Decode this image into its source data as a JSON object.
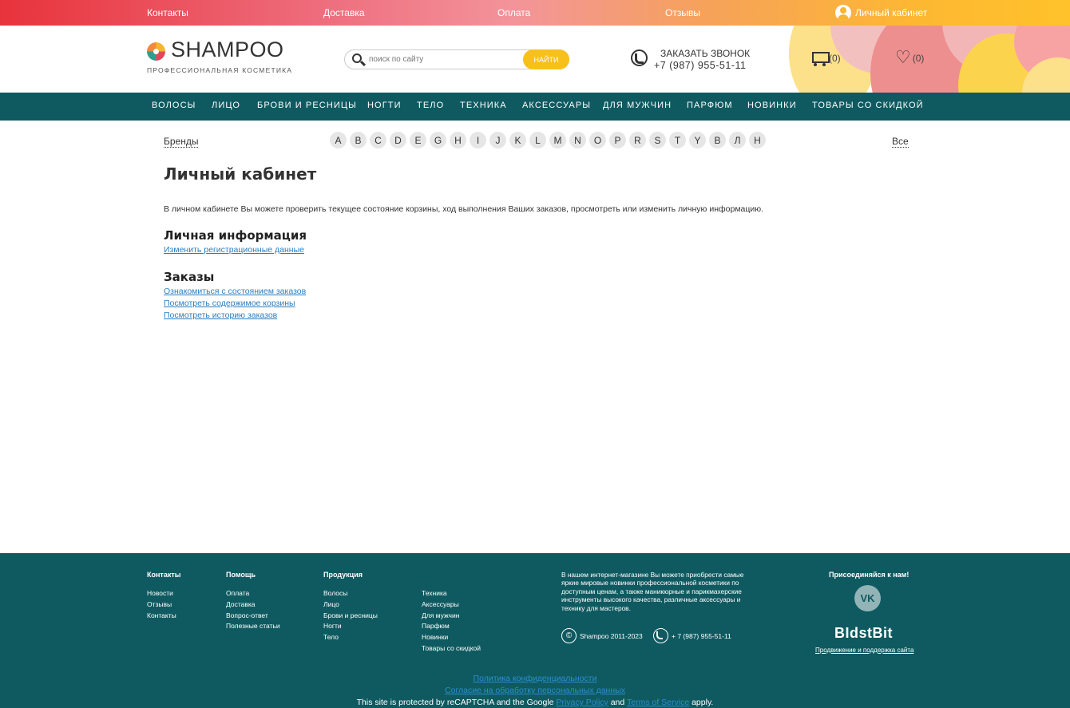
{
  "topbar": {
    "links": [
      "Контакты",
      "Доставка",
      "Оплата",
      "Отзывы"
    ],
    "account_label": "Личный кабинет"
  },
  "header": {
    "logo_text": "SHAMPOO",
    "logo_sub": "ПРОФЕССИОНАЛЬНАЯ КОСМЕТИКА",
    "search_placeholder": "поиск по сайту",
    "search_button": "НАЙТИ",
    "callback_title": "ЗАКАЗАТЬ ЗВОНОК",
    "callback_phone": "+7 (987) 955-51-11",
    "cart_count": "(0)",
    "fav_count": "(0)"
  },
  "nav": [
    "ВОЛОСЫ",
    "ЛИЦО",
    "БРОВИ И РЕСНИЦЫ",
    "НОГТИ",
    "ТЕЛО",
    "ТЕХНИКА",
    "АКСЕССУАРЫ",
    "ДЛЯ МУЖЧИН",
    "ПАРФЮМ",
    "НОВИНКИ",
    "ТОВАРЫ СО СКИДКОЙ"
  ],
  "brands": {
    "label": "Бренды",
    "letters": [
      "A",
      "B",
      "C",
      "D",
      "E",
      "G",
      "H",
      "I",
      "J",
      "K",
      "L",
      "M",
      "N",
      "O",
      "P",
      "R",
      "S",
      "T",
      "Y",
      "В",
      "Л",
      "Н"
    ],
    "all_label": "Все"
  },
  "content": {
    "title": "Личный кабинет",
    "intro": "В личном кабинете Вы можете проверить текущее состояние корзины, ход выполнения Ваших заказов, просмотреть или изменить личную информацию.",
    "personal_title": "Личная информация",
    "personal_link": "Изменить регистрационные данные",
    "orders_title": "Заказы",
    "order_links": [
      "Ознакомиться с состоянием заказов",
      "Посмотреть содержимое корзины",
      "Посмотреть историю заказов"
    ]
  },
  "footer": {
    "contacts_head": "Контакты",
    "contacts": [
      "Новости",
      "Отзывы",
      "Контакты"
    ],
    "help_head": "Помощь",
    "help": [
      "Оплата",
      "Доставка",
      "Вопрос-ответ",
      "Полезные статьи"
    ],
    "products_head": "Продукция",
    "products_col1": [
      "Волосы",
      "Лицо",
      "Брови и ресницы",
      "Ногти",
      "Тело"
    ],
    "products_col2": [
      "Техника",
      "Аксессуары",
      "Для мужчин",
      "Парфюм",
      "Новинки",
      "Товары со скидкой"
    ],
    "about": "В нашем интернет-магазине Вы можете приобрести самые яркие мировые новинки профессиональной косметики по доступным ценам, а также маникюрные и парикмахерские инструменты высокого качества, различные аксессуары и технику для мастеров.",
    "copyright": "Shampoo 2011-2023",
    "phone": "+ 7 (987) 955-51-11",
    "join": "Присоединяйся к нам!",
    "vk": "VK",
    "dev_name": "BIdstBit",
    "dev_sub": "Продвижение и поддержка сайта",
    "privacy": "Политика конфиденциальности",
    "consent": "Согласие на обработку персональных данных",
    "recaptcha_pre": "This site is protected by reCAPTCHA and the Google",
    "privacy_policy": "Privacy Policy",
    "and": "and",
    "terms": "Terms of Service",
    "apply": "apply."
  },
  "colors": {
    "nav_bg": "#0f5a60",
    "accent": "#f8c01a",
    "link": "#2a7ec0"
  }
}
